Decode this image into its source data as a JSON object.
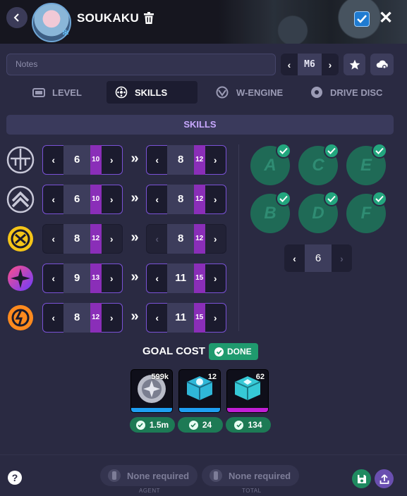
{
  "header": {
    "character_name": "SOUKAKU"
  },
  "notes": {
    "placeholder": "Notes"
  },
  "mindscape": {
    "value": "M6"
  },
  "tabs": [
    {
      "label": "LEVEL",
      "icon": "tv-icon"
    },
    {
      "label": "SKILLS",
      "icon": "skills-icon",
      "active": true
    },
    {
      "label": "W-ENGINE",
      "icon": "w-engine-icon"
    },
    {
      "label": "DRIVE DISC",
      "icon": "drive-disc-icon"
    }
  ],
  "section": {
    "title": "SKILLS"
  },
  "skills": [
    {
      "icon": "basic-attack-icon",
      "current": "6",
      "current_max": "10",
      "goal": "8",
      "goal_max": "12"
    },
    {
      "icon": "dodge-icon",
      "current": "6",
      "current_max": "10",
      "goal": "8",
      "goal_max": "12"
    },
    {
      "icon": "assist-icon",
      "current": "8",
      "current_max": "12",
      "goal": "8",
      "goal_max": "12"
    },
    {
      "icon": "special-attack-icon",
      "current": "9",
      "current_max": "13",
      "goal": "11",
      "goal_max": "15"
    },
    {
      "icon": "chain-attack-icon",
      "current": "8",
      "current_max": "12",
      "goal": "11",
      "goal_max": "15"
    }
  ],
  "core_nodes": [
    "A",
    "C",
    "E",
    "B",
    "D",
    "F"
  ],
  "core_level": {
    "value": "6"
  },
  "goal_cost": {
    "title": "GOAL COST",
    "status": "DONE",
    "materials": [
      {
        "icon": "denny-coin-icon",
        "qty": "599k",
        "owned": "1.5m",
        "bar_color": "#1e9ff2"
      },
      {
        "icon": "skill-material-advanced-icon",
        "qty": "12",
        "owned": "24",
        "bar_color": "#1e9ff2"
      },
      {
        "icon": "skill-material-specialized-icon",
        "qty": "62",
        "owned": "134",
        "bar_color": "#c21ed6"
      }
    ]
  },
  "footer": {
    "agent_label": "None required",
    "agent_caption": "AGENT",
    "total_label": "None required",
    "total_caption": "TOTAL",
    "help": "?"
  }
}
